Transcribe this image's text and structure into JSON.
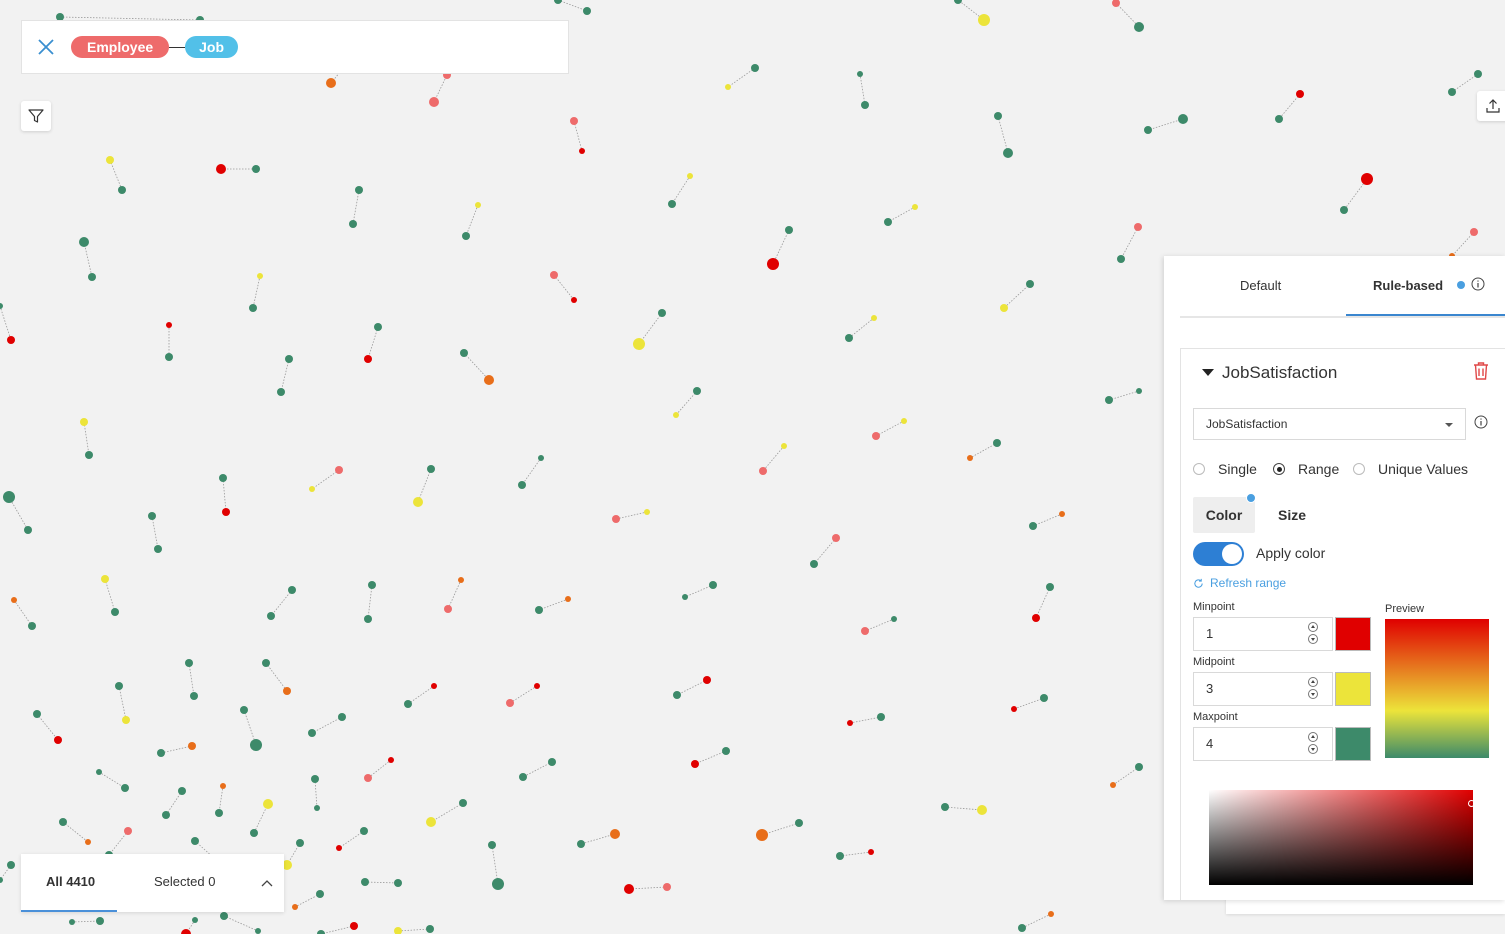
{
  "query": {
    "close_icon": "close-icon",
    "nodes": [
      "Employee",
      "Job"
    ],
    "employee_color": "#ee6b6b",
    "job_color": "#52c0e8"
  },
  "toolbar": {
    "filter_icon": "filter-icon",
    "export_icon": "upload-icon"
  },
  "selection": {
    "all_label": "All 4410",
    "selected_label": "Selected 0"
  },
  "style_panel": {
    "tabs": [
      "Default",
      "Rule-based"
    ],
    "active_tab": "Rule-based",
    "rule": {
      "title": "JobSatisfaction",
      "property": "JobSatisfaction",
      "modes": [
        "Single",
        "Range",
        "Unique Values"
      ],
      "selected_mode": "Range",
      "subtabs": [
        "Color",
        "Size"
      ],
      "apply_color_label": "Apply color",
      "apply_color_on": true,
      "refresh_label": "Refresh range",
      "points": [
        {
          "label": "Minpoint",
          "value": "1",
          "color": "#e00000"
        },
        {
          "label": "Midpoint",
          "value": "3",
          "color": "#ece43a"
        },
        {
          "label": "Maxpoint",
          "value": "4",
          "color": "#3d8a6a"
        }
      ],
      "preview_label": "Preview"
    }
  },
  "graph": {
    "colors": {
      "red": "#e00000",
      "salmon": "#ee6b6b",
      "orange": "#e86e1a",
      "yellow": "#ece43a",
      "green": "#3d8a6a"
    },
    "pairs": [
      [
        60,
        17,
        "g",
        4,
        200,
        20,
        "g",
        4
      ],
      [
        558,
        0,
        "g",
        4,
        587,
        11,
        "g",
        4
      ],
      [
        984,
        20,
        "y",
        6,
        958,
        0,
        "g",
        4
      ],
      [
        1116,
        3,
        "s",
        4,
        1139,
        27,
        "g",
        5
      ],
      [
        331,
        83,
        "o",
        5,
        350,
        60,
        "g",
        4
      ],
      [
        434,
        102,
        "s",
        5,
        447,
        75,
        "s",
        4
      ],
      [
        755,
        68,
        "g",
        4,
        728,
        87,
        "y",
        3
      ],
      [
        860,
        74,
        "g",
        3,
        865,
        105,
        "g",
        4
      ],
      [
        1300,
        94,
        "r",
        4,
        1279,
        119,
        "g",
        4
      ],
      [
        1478,
        74,
        "g",
        4,
        1452,
        92,
        "g",
        4
      ],
      [
        1183,
        119,
        "g",
        5,
        1148,
        130,
        "g",
        4
      ],
      [
        574,
        121,
        "s",
        4,
        582,
        151,
        "r",
        3
      ],
      [
        998,
        116,
        "g",
        4,
        1008,
        153,
        "g",
        5
      ],
      [
        110,
        160,
        "y",
        4,
        122,
        190,
        "g",
        4
      ],
      [
        221,
        169,
        "r",
        5,
        256,
        169,
        "g",
        4
      ],
      [
        690,
        176,
        "y",
        3,
        672,
        204,
        "g",
        4
      ],
      [
        1367,
        179,
        "r",
        6,
        1344,
        210,
        "g",
        4
      ],
      [
        359,
        190,
        "g",
        4,
        353,
        224,
        "g",
        4
      ],
      [
        478,
        205,
        "y",
        3,
        466,
        236,
        "g",
        4
      ],
      [
        915,
        207,
        "y",
        3,
        888,
        222,
        "g",
        4
      ],
      [
        789,
        230,
        "g",
        4,
        773,
        264,
        "r",
        6
      ],
      [
        1138,
        227,
        "s",
        4,
        1121,
        259,
        "g",
        4
      ],
      [
        84,
        242,
        "g",
        5,
        92,
        277,
        "g",
        4
      ],
      [
        554,
        275,
        "s",
        4,
        574,
        300,
        "r",
        3
      ],
      [
        260,
        276,
        "y",
        3,
        253,
        308,
        "g",
        4
      ],
      [
        1474,
        232,
        "s",
        4,
        1452,
        256,
        "o",
        3
      ],
      [
        1030,
        284,
        "g",
        4,
        1004,
        308,
        "y",
        4
      ],
      [
        662,
        313,
        "g",
        4,
        639,
        344,
        "y",
        6
      ],
      [
        874,
        318,
        "y",
        3,
        849,
        338,
        "g",
        4
      ],
      [
        0,
        306,
        "g",
        3,
        11,
        340,
        "r",
        4
      ],
      [
        169,
        325,
        "r",
        3,
        169,
        357,
        "g",
        4
      ],
      [
        378,
        327,
        "g",
        4,
        368,
        359,
        "r",
        4
      ],
      [
        464,
        353,
        "g",
        4,
        489,
        380,
        "o",
        5
      ],
      [
        289,
        359,
        "g",
        4,
        281,
        392,
        "g",
        4
      ],
      [
        697,
        391,
        "g",
        4,
        676,
        415,
        "y",
        3
      ],
      [
        904,
        421,
        "y",
        3,
        876,
        436,
        "s",
        4
      ],
      [
        1139,
        391,
        "g",
        3,
        1109,
        400,
        "g",
        4
      ],
      [
        84,
        422,
        "y",
        4,
        89,
        455,
        "g",
        4
      ],
      [
        784,
        446,
        "y",
        3,
        763,
        471,
        "s",
        4
      ],
      [
        997,
        443,
        "g",
        4,
        970,
        458,
        "o",
        3
      ],
      [
        339,
        470,
        "s",
        4,
        312,
        489,
        "y",
        3
      ],
      [
        431,
        469,
        "g",
        4,
        418,
        502,
        "y",
        5
      ],
      [
        541,
        458,
        "g",
        3,
        522,
        485,
        "g",
        4
      ],
      [
        9,
        497,
        "g",
        6,
        28,
        530,
        "g",
        4
      ],
      [
        223,
        478,
        "g",
        4,
        226,
        512,
        "r",
        4
      ],
      [
        647,
        512,
        "y",
        3,
        616,
        519,
        "s",
        4
      ],
      [
        1062,
        514,
        "o",
        3,
        1033,
        526,
        "g",
        4
      ],
      [
        152,
        516,
        "g",
        4,
        158,
        549,
        "g",
        4
      ],
      [
        836,
        538,
        "s",
        4,
        814,
        564,
        "g",
        4
      ],
      [
        105,
        579,
        "y",
        4,
        115,
        612,
        "g",
        4
      ],
      [
        292,
        590,
        "g",
        4,
        271,
        616,
        "g",
        4
      ],
      [
        372,
        585,
        "g",
        4,
        368,
        619,
        "g",
        4
      ],
      [
        461,
        580,
        "o",
        3,
        448,
        609,
        "s",
        4
      ],
      [
        568,
        599,
        "o",
        3,
        539,
        610,
        "g",
        4
      ],
      [
        713,
        585,
        "g",
        4,
        685,
        597,
        "g",
        3
      ],
      [
        1050,
        587,
        "g",
        4,
        1036,
        618,
        "r",
        4
      ],
      [
        14,
        600,
        "o",
        3,
        32,
        626,
        "g",
        4
      ],
      [
        894,
        619,
        "g",
        3,
        865,
        631,
        "s",
        4
      ],
      [
        189,
        663,
        "g",
        4,
        194,
        696,
        "g",
        4
      ],
      [
        266,
        663,
        "g",
        4,
        287,
        691,
        "o",
        4
      ],
      [
        119,
        686,
        "g",
        4,
        126,
        720,
        "y",
        4
      ],
      [
        434,
        686,
        "r",
        3,
        408,
        704,
        "g",
        4
      ],
      [
        537,
        686,
        "r",
        3,
        510,
        703,
        "s",
        4
      ],
      [
        707,
        680,
        "r",
        4,
        677,
        695,
        "g",
        4
      ],
      [
        1044,
        698,
        "g",
        4,
        1014,
        709,
        "r",
        3
      ],
      [
        37,
        714,
        "g",
        4,
        58,
        740,
        "r",
        4
      ],
      [
        244,
        710,
        "g",
        4,
        256,
        745,
        "g",
        6
      ],
      [
        342,
        717,
        "g",
        4,
        312,
        733,
        "g",
        4
      ],
      [
        881,
        717,
        "g",
        4,
        850,
        723,
        "r",
        3
      ],
      [
        192,
        746,
        "o",
        4,
        161,
        753,
        "g",
        4
      ],
      [
        726,
        751,
        "g",
        4,
        695,
        764,
        "r",
        4
      ],
      [
        391,
        760,
        "r",
        3,
        368,
        778,
        "s",
        4
      ],
      [
        552,
        762,
        "g",
        4,
        523,
        777,
        "g",
        4
      ],
      [
        1139,
        767,
        "g",
        4,
        1113,
        785,
        "o",
        3
      ],
      [
        99,
        772,
        "g",
        3,
        125,
        788,
        "g",
        4
      ],
      [
        315,
        779,
        "g",
        4,
        317,
        808,
        "g",
        3
      ],
      [
        223,
        786,
        "o",
        3,
        219,
        813,
        "g",
        4
      ],
      [
        182,
        791,
        "g",
        4,
        166,
        815,
        "g",
        4
      ],
      [
        268,
        804,
        "y",
        5,
        254,
        833,
        "g",
        4
      ],
      [
        463,
        803,
        "g",
        4,
        431,
        822,
        "y",
        5
      ],
      [
        945,
        807,
        "g",
        4,
        982,
        810,
        "y",
        5
      ],
      [
        63,
        822,
        "g",
        4,
        88,
        842,
        "o",
        3
      ],
      [
        799,
        823,
        "g",
        4,
        762,
        835,
        "o",
        6
      ],
      [
        128,
        831,
        "s",
        4,
        109,
        855,
        "g",
        4
      ],
      [
        364,
        831,
        "g",
        4,
        339,
        848,
        "r",
        3
      ],
      [
        615,
        834,
        "o",
        5,
        581,
        844,
        "g",
        4
      ],
      [
        492,
        845,
        "g",
        4,
        498,
        884,
        "g",
        6
      ],
      [
        871,
        852,
        "r",
        3,
        840,
        856,
        "g",
        4
      ],
      [
        300,
        843,
        "g",
        4,
        287,
        865,
        "y",
        5
      ],
      [
        11,
        865,
        "g",
        4,
        0,
        880,
        "g",
        3
      ],
      [
        365,
        882,
        "g",
        4,
        398,
        883,
        "g",
        4
      ],
      [
        667,
        887,
        "s",
        4,
        629,
        889,
        "r",
        5
      ],
      [
        320,
        894,
        "g",
        4,
        295,
        907,
        "o",
        3
      ],
      [
        1051,
        914,
        "o",
        3,
        1022,
        928,
        "g",
        4
      ],
      [
        72,
        922,
        "g",
        3,
        100,
        921,
        "g",
        4
      ],
      [
        354,
        926,
        "r",
        4,
        321,
        934,
        "g",
        4
      ],
      [
        430,
        929,
        "g",
        4,
        398,
        931,
        "y",
        4
      ],
      [
        224,
        916,
        "g",
        4,
        258,
        931,
        "g",
        3
      ],
      [
        195,
        841,
        "g",
        4,
        214,
        858,
        "g",
        4
      ],
      [
        186,
        934,
        "r",
        5,
        195,
        920,
        "g",
        3
      ]
    ]
  }
}
